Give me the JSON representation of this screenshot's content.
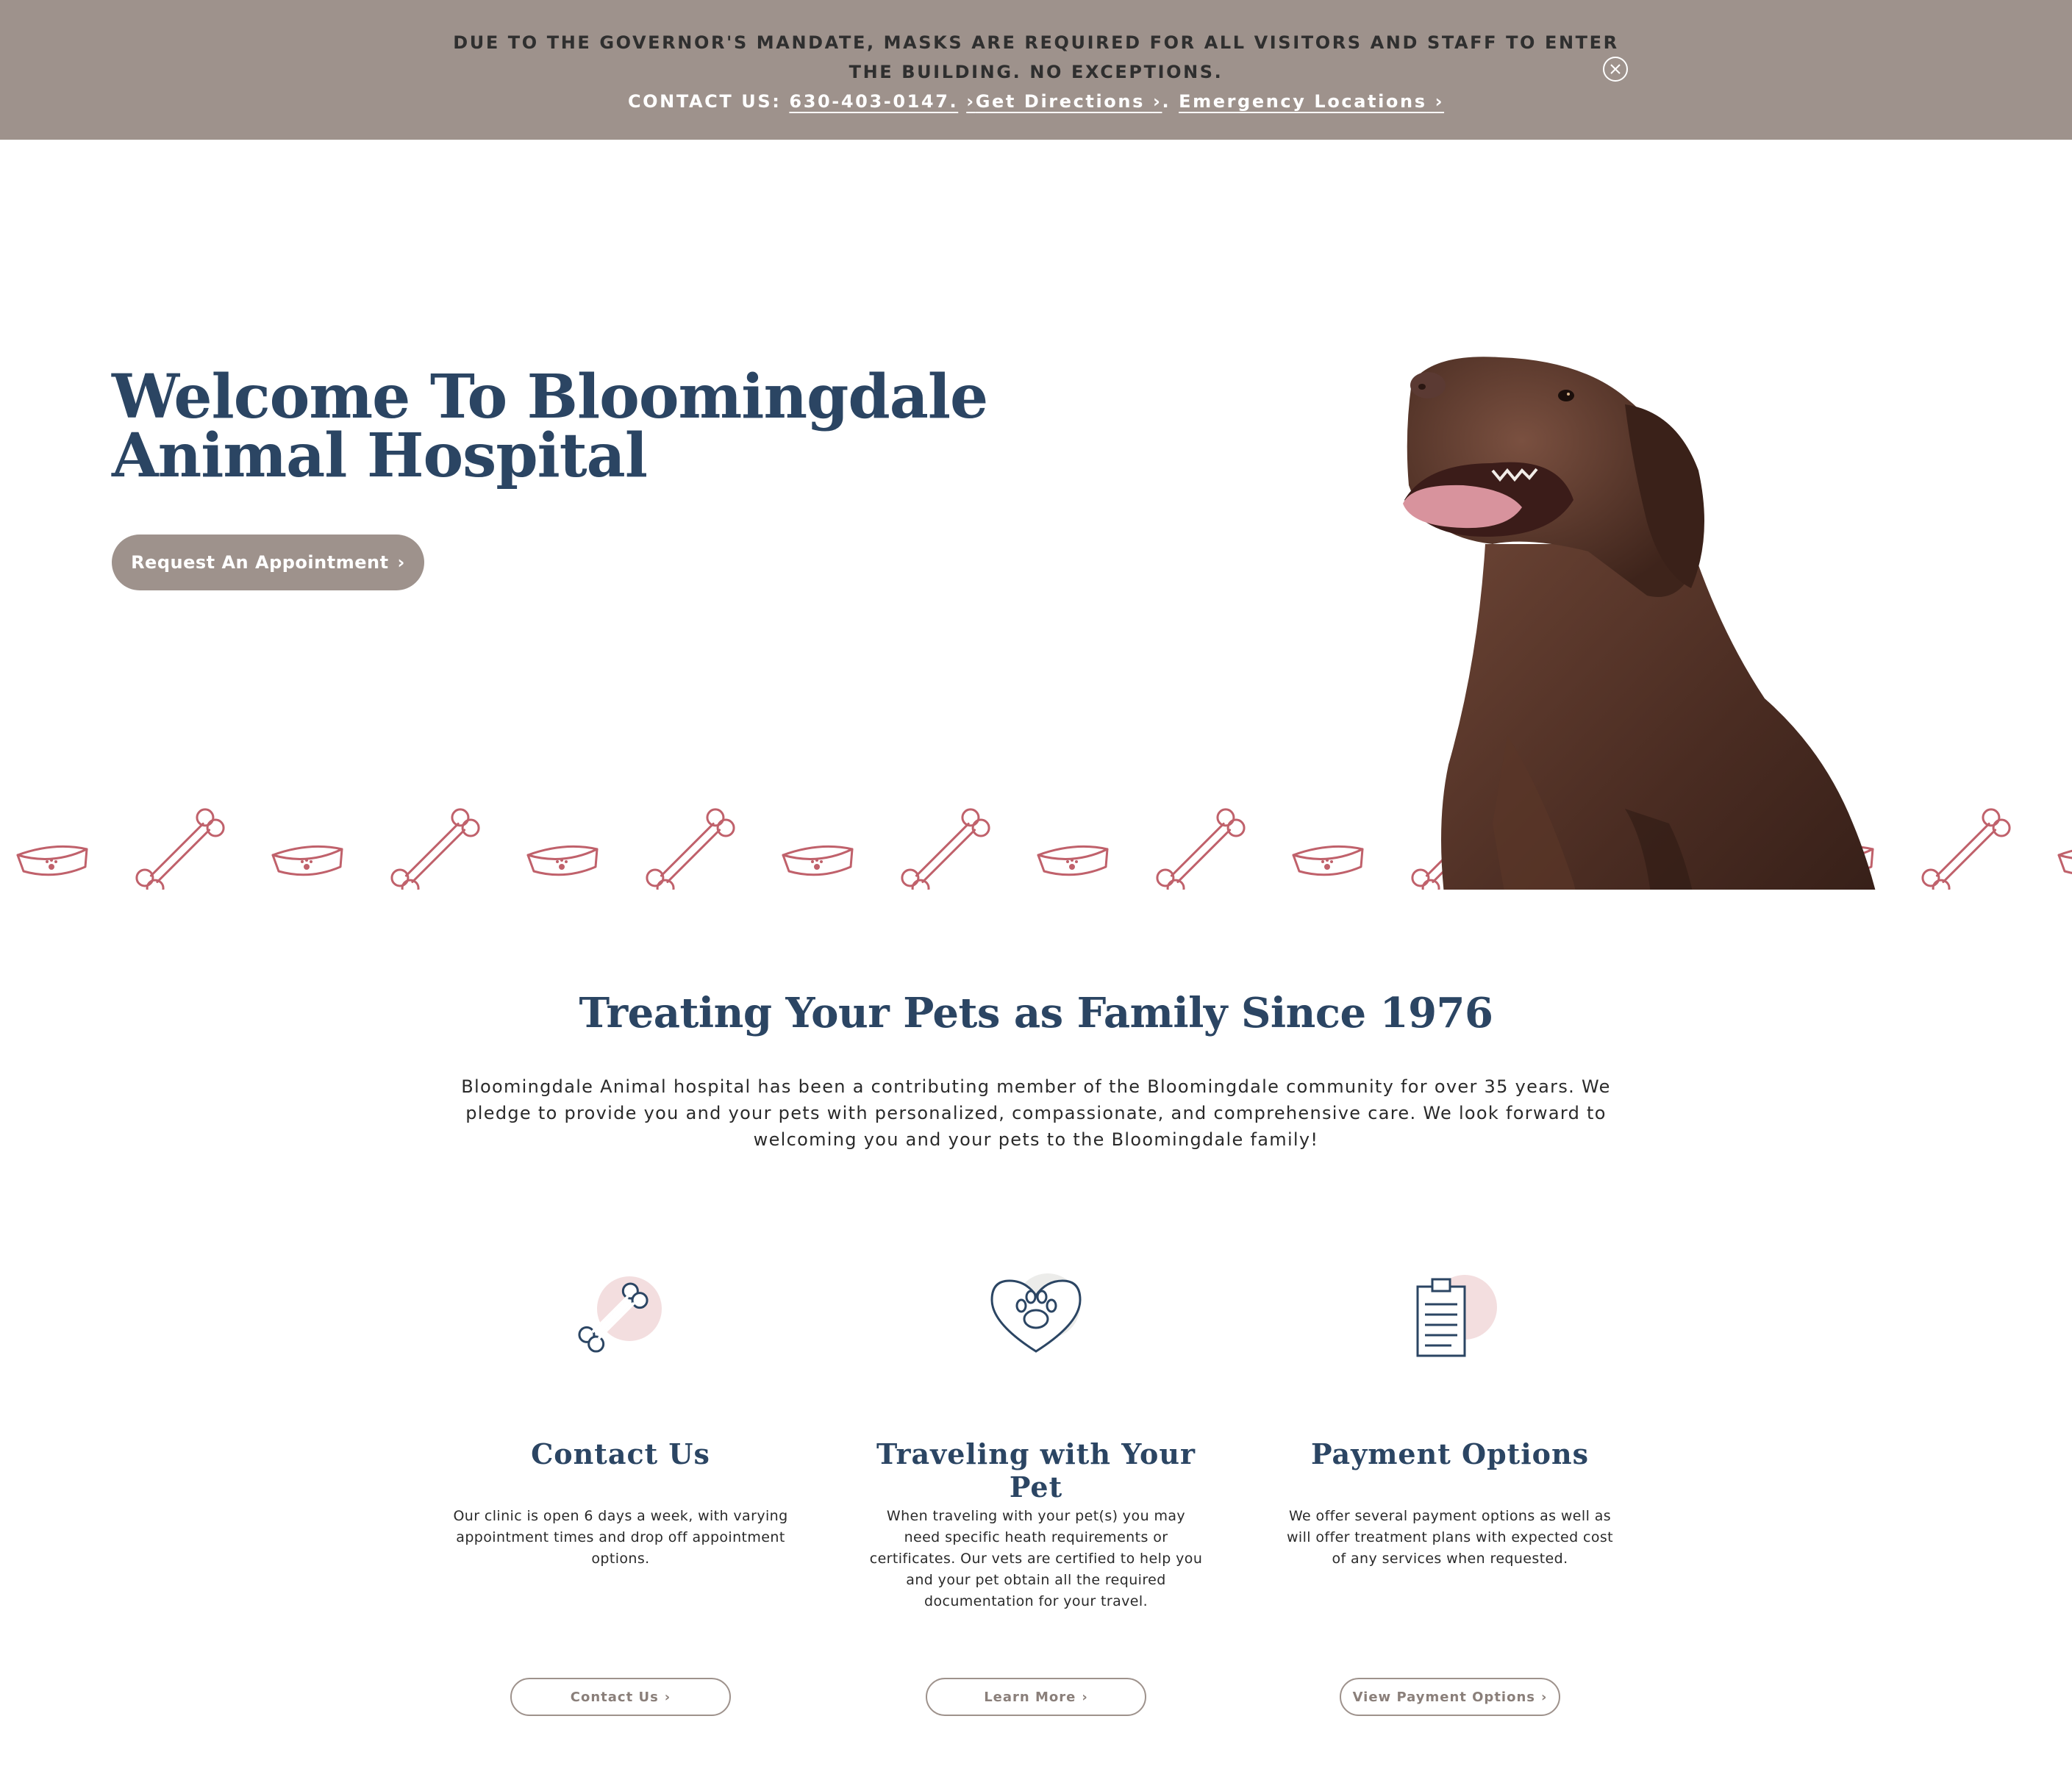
{
  "alert": {
    "message": "DUE TO THE GOVERNOR'S MANDATE, MASKS ARE REQUIRED FOR ALL VISITORS AND STAFF TO ENTER THE BUILDING. NO EXCEPTIONS.",
    "contact_prefix": "CONTACT US:",
    "phone": "630-403-0147.",
    "directions_label": "Get Directions",
    "separator": ".",
    "emergency_label": "Emergency Locations"
  },
  "hero": {
    "title": "Welcome To Bloomingdale Animal Hospital",
    "cta_label": "Request An Appointment"
  },
  "intro": {
    "title": "Treating Your Pets as Family Since 1976",
    "text": "Bloomingdale Animal hospital has been a contributing member of the Bloomingdale community for over 35 years. We pledge to provide you and your pets with personalized, compassionate, and comprehensive care. We look forward to welcoming you and your pets to the Bloomingdale family!"
  },
  "features": [
    {
      "icon": "bone-icon",
      "title": "Contact Us",
      "text": "Our clinic is open 6 days a week, with varying appointment times and drop off appointment options.",
      "button": "Contact Us"
    },
    {
      "icon": "heart-paw-icon",
      "title": "Traveling with Your Pet",
      "text": "When traveling with your pet(s) you may need specific heath requirements or certificates. Our vets are certified to help you and your pet obtain all the required documentation for your travel.",
      "button": "Learn More"
    },
    {
      "icon": "clipboard-icon",
      "title": "Payment Options",
      "text": "We offer several payment options as well as will offer treatment plans with expected cost of any services when requested.",
      "button": "View Payment Options"
    }
  ],
  "colors": {
    "alert_bg": "#9e928c",
    "heading": "#2b4563",
    "pattern": "#c0616b",
    "accent_red": "#b5434e",
    "dog_brown": "#4a2c22"
  }
}
